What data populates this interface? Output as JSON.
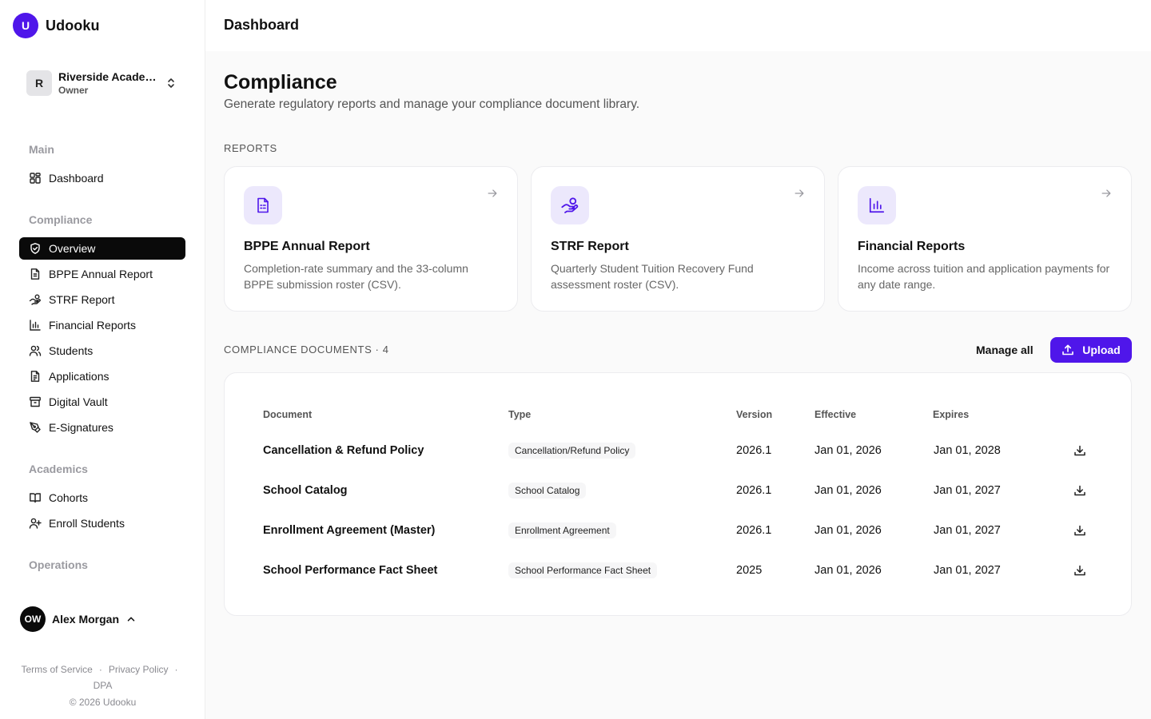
{
  "brand": {
    "logo_letter": "U",
    "name": "Udooku"
  },
  "org": {
    "avatar_letter": "R",
    "name": "Riverside Academ...",
    "role": "Owner"
  },
  "nav": {
    "sections": {
      "main": "Main",
      "compliance": "Compliance",
      "academics": "Academics",
      "operations": "Operations"
    },
    "items": {
      "dashboard": "Dashboard",
      "overview": "Overview",
      "bppe": "BPPE Annual Report",
      "strf": "STRF Report",
      "financial": "Financial Reports",
      "students": "Students",
      "applications": "Applications",
      "vault": "Digital Vault",
      "esign": "E-Signatures",
      "cohorts": "Cohorts",
      "enroll": "Enroll Students"
    },
    "active": "overview"
  },
  "user": {
    "initials": "OW",
    "name": "Alex Morgan"
  },
  "footer": {
    "terms": "Terms of Service",
    "privacy": "Privacy Policy",
    "dpa": "DPA",
    "sep": "·",
    "copyright": "© 2026 Udooku"
  },
  "topbar": {
    "title": "Dashboard"
  },
  "page": {
    "title": "Compliance",
    "subtitle": "Generate regulatory reports and manage your compliance document library."
  },
  "reports": {
    "label": "REPORTS",
    "cards": [
      {
        "title": "BPPE Annual Report",
        "description": "Completion-rate summary and the 33-column BPPE submission roster (CSV).",
        "icon": "file-text-icon"
      },
      {
        "title": "STRF Report",
        "description": "Quarterly Student Tuition Recovery Fund assessment roster (CSV).",
        "icon": "hand-coins-icon"
      },
      {
        "title": "Financial Reports",
        "description": "Income across tuition and application payments for any date range.",
        "icon": "bar-chart-icon"
      }
    ]
  },
  "documents": {
    "label": "COMPLIANCE DOCUMENTS · 4",
    "manage_all": "Manage all",
    "upload": "Upload",
    "columns": {
      "document": "Document",
      "type": "Type",
      "version": "Version",
      "effective": "Effective",
      "expires": "Expires"
    },
    "rows": [
      {
        "document": "Cancellation & Refund Policy",
        "type": "Cancellation/Refund Policy",
        "version": "2026.1",
        "effective": "Jan 01, 2026",
        "expires": "Jan 01, 2028"
      },
      {
        "document": "School Catalog",
        "type": "School Catalog",
        "version": "2026.1",
        "effective": "Jan 01, 2026",
        "expires": "Jan 01, 2027"
      },
      {
        "document": "Enrollment Agreement (Master)",
        "type": "Enrollment Agreement",
        "version": "2026.1",
        "effective": "Jan 01, 2026",
        "expires": "Jan 01, 2027"
      },
      {
        "document": "School Performance Fact Sheet",
        "type": "School Performance Fact Sheet",
        "version": "2025",
        "effective": "Jan 01, 2026",
        "expires": "Jan 01, 2027"
      }
    ]
  },
  "colors": {
    "accent": "#4f16ea",
    "accent_soft": "#ece8fc",
    "active_nav": "#0a0a0a"
  }
}
